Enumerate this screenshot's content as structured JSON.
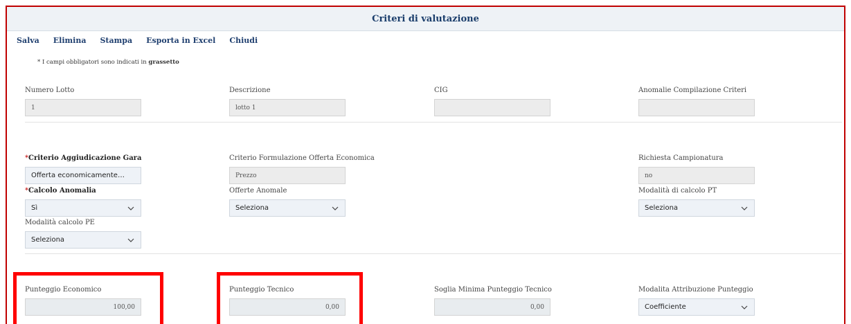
{
  "window": {
    "title": "Criteri di valutazione"
  },
  "toolbar": {
    "salva": "Salva",
    "elimina": "Elimina",
    "stampa": "Stampa",
    "esporta": "Esporta in Excel",
    "chiudi": "Chiudi"
  },
  "note": {
    "text": "* I campi obbligatori sono indicati in ",
    "bold": "grassetto"
  },
  "section1": {
    "numero_lotto": {
      "label": "Numero Lotto",
      "value": "1"
    },
    "descrizione": {
      "label": "Descrizione",
      "value": "lotto 1"
    },
    "cig": {
      "label": "CIG",
      "value": ""
    },
    "anomalie": {
      "label": "Anomalie Compilazione Criteri",
      "value": ""
    }
  },
  "section2": {
    "criterio_aggiudicazione": {
      "star": "*",
      "label": "Criterio Aggiudicazione Gara",
      "value": "Offerta economicamente più vantaggiosa"
    },
    "criterio_formulazione": {
      "label": "Criterio Formulazione Offerta Economica",
      "value": "Prezzo"
    },
    "richiesta_campionatura": {
      "label": "Richiesta Campionatura",
      "value": "no"
    },
    "calcolo_anomalia": {
      "star": "*",
      "label": "Calcolo Anomalia",
      "value": "Sì"
    },
    "offerte_anomale": {
      "label": "Offerte Anomale",
      "value": "Seleziona"
    },
    "modalita_calcolo_pt": {
      "label": "Modalità di calcolo PT",
      "value": "Seleziona"
    },
    "modalita_calcolo_pe": {
      "label": "Modalità calcolo PE",
      "value": "Seleziona"
    }
  },
  "section3": {
    "punteggio_economico": {
      "label": "Punteggio Economico",
      "value": "100,00"
    },
    "punteggio_tecnico": {
      "label": "Punteggio Tecnico",
      "value": "0,00"
    },
    "soglia_minima": {
      "label": "Soglia Minima Punteggio Tecnico",
      "value": "0,00"
    },
    "modalita_attribuzione": {
      "label": "Modalita Attribuzione Punteggio",
      "value": "Coefficiente"
    }
  },
  "colors": {
    "highlight": "#ff0000",
    "border": "#c00000",
    "title": "#1a3d6b"
  },
  "icons": {
    "dropdown": "chevron-down-icon"
  }
}
